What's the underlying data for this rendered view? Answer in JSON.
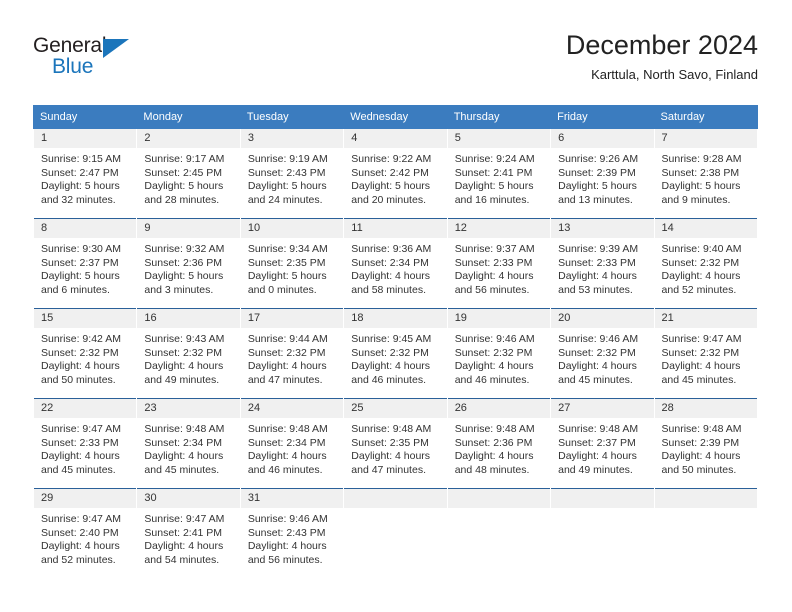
{
  "logo": {
    "word_top": "General",
    "word_bottom": "Blue",
    "triangle_color": "#1b75bb"
  },
  "header": {
    "title": "December 2024",
    "location": "Karttula, North Savo, Finland"
  },
  "theme": {
    "header_blue": "#3b7cbf",
    "rule_blue": "#2a6099",
    "daynum_background": "#f0f0f0",
    "text": "#333333"
  },
  "calendar": {
    "weekday_headers": [
      "Sunday",
      "Monday",
      "Tuesday",
      "Wednesday",
      "Thursday",
      "Friday",
      "Saturday"
    ],
    "labels": {
      "sunrise": "Sunrise:",
      "sunset": "Sunset:",
      "daylight": "Daylight:"
    },
    "weeks": [
      [
        {
          "day": "1",
          "sunrise": "Sunrise: 9:15 AM",
          "sunset": "Sunset: 2:47 PM",
          "daylight_1": "Daylight: 5 hours",
          "daylight_2": "and 32 minutes."
        },
        {
          "day": "2",
          "sunrise": "Sunrise: 9:17 AM",
          "sunset": "Sunset: 2:45 PM",
          "daylight_1": "Daylight: 5 hours",
          "daylight_2": "and 28 minutes."
        },
        {
          "day": "3",
          "sunrise": "Sunrise: 9:19 AM",
          "sunset": "Sunset: 2:43 PM",
          "daylight_1": "Daylight: 5 hours",
          "daylight_2": "and 24 minutes."
        },
        {
          "day": "4",
          "sunrise": "Sunrise: 9:22 AM",
          "sunset": "Sunset: 2:42 PM",
          "daylight_1": "Daylight: 5 hours",
          "daylight_2": "and 20 minutes."
        },
        {
          "day": "5",
          "sunrise": "Sunrise: 9:24 AM",
          "sunset": "Sunset: 2:41 PM",
          "daylight_1": "Daylight: 5 hours",
          "daylight_2": "and 16 minutes."
        },
        {
          "day": "6",
          "sunrise": "Sunrise: 9:26 AM",
          "sunset": "Sunset: 2:39 PM",
          "daylight_1": "Daylight: 5 hours",
          "daylight_2": "and 13 minutes."
        },
        {
          "day": "7",
          "sunrise": "Sunrise: 9:28 AM",
          "sunset": "Sunset: 2:38 PM",
          "daylight_1": "Daylight: 5 hours",
          "daylight_2": "and 9 minutes."
        }
      ],
      [
        {
          "day": "8",
          "sunrise": "Sunrise: 9:30 AM",
          "sunset": "Sunset: 2:37 PM",
          "daylight_1": "Daylight: 5 hours",
          "daylight_2": "and 6 minutes."
        },
        {
          "day": "9",
          "sunrise": "Sunrise: 9:32 AM",
          "sunset": "Sunset: 2:36 PM",
          "daylight_1": "Daylight: 5 hours",
          "daylight_2": "and 3 minutes."
        },
        {
          "day": "10",
          "sunrise": "Sunrise: 9:34 AM",
          "sunset": "Sunset: 2:35 PM",
          "daylight_1": "Daylight: 5 hours",
          "daylight_2": "and 0 minutes."
        },
        {
          "day": "11",
          "sunrise": "Sunrise: 9:36 AM",
          "sunset": "Sunset: 2:34 PM",
          "daylight_1": "Daylight: 4 hours",
          "daylight_2": "and 58 minutes."
        },
        {
          "day": "12",
          "sunrise": "Sunrise: 9:37 AM",
          "sunset": "Sunset: 2:33 PM",
          "daylight_1": "Daylight: 4 hours",
          "daylight_2": "and 56 minutes."
        },
        {
          "day": "13",
          "sunrise": "Sunrise: 9:39 AM",
          "sunset": "Sunset: 2:33 PM",
          "daylight_1": "Daylight: 4 hours",
          "daylight_2": "and 53 minutes."
        },
        {
          "day": "14",
          "sunrise": "Sunrise: 9:40 AM",
          "sunset": "Sunset: 2:32 PM",
          "daylight_1": "Daylight: 4 hours",
          "daylight_2": "and 52 minutes."
        }
      ],
      [
        {
          "day": "15",
          "sunrise": "Sunrise: 9:42 AM",
          "sunset": "Sunset: 2:32 PM",
          "daylight_1": "Daylight: 4 hours",
          "daylight_2": "and 50 minutes."
        },
        {
          "day": "16",
          "sunrise": "Sunrise: 9:43 AM",
          "sunset": "Sunset: 2:32 PM",
          "daylight_1": "Daylight: 4 hours",
          "daylight_2": "and 49 minutes."
        },
        {
          "day": "17",
          "sunrise": "Sunrise: 9:44 AM",
          "sunset": "Sunset: 2:32 PM",
          "daylight_1": "Daylight: 4 hours",
          "daylight_2": "and 47 minutes."
        },
        {
          "day": "18",
          "sunrise": "Sunrise: 9:45 AM",
          "sunset": "Sunset: 2:32 PM",
          "daylight_1": "Daylight: 4 hours",
          "daylight_2": "and 46 minutes."
        },
        {
          "day": "19",
          "sunrise": "Sunrise: 9:46 AM",
          "sunset": "Sunset: 2:32 PM",
          "daylight_1": "Daylight: 4 hours",
          "daylight_2": "and 46 minutes."
        },
        {
          "day": "20",
          "sunrise": "Sunrise: 9:46 AM",
          "sunset": "Sunset: 2:32 PM",
          "daylight_1": "Daylight: 4 hours",
          "daylight_2": "and 45 minutes."
        },
        {
          "day": "21",
          "sunrise": "Sunrise: 9:47 AM",
          "sunset": "Sunset: 2:32 PM",
          "daylight_1": "Daylight: 4 hours",
          "daylight_2": "and 45 minutes."
        }
      ],
      [
        {
          "day": "22",
          "sunrise": "Sunrise: 9:47 AM",
          "sunset": "Sunset: 2:33 PM",
          "daylight_1": "Daylight: 4 hours",
          "daylight_2": "and 45 minutes."
        },
        {
          "day": "23",
          "sunrise": "Sunrise: 9:48 AM",
          "sunset": "Sunset: 2:34 PM",
          "daylight_1": "Daylight: 4 hours",
          "daylight_2": "and 45 minutes."
        },
        {
          "day": "24",
          "sunrise": "Sunrise: 9:48 AM",
          "sunset": "Sunset: 2:34 PM",
          "daylight_1": "Daylight: 4 hours",
          "daylight_2": "and 46 minutes."
        },
        {
          "day": "25",
          "sunrise": "Sunrise: 9:48 AM",
          "sunset": "Sunset: 2:35 PM",
          "daylight_1": "Daylight: 4 hours",
          "daylight_2": "and 47 minutes."
        },
        {
          "day": "26",
          "sunrise": "Sunrise: 9:48 AM",
          "sunset": "Sunset: 2:36 PM",
          "daylight_1": "Daylight: 4 hours",
          "daylight_2": "and 48 minutes."
        },
        {
          "day": "27",
          "sunrise": "Sunrise: 9:48 AM",
          "sunset": "Sunset: 2:37 PM",
          "daylight_1": "Daylight: 4 hours",
          "daylight_2": "and 49 minutes."
        },
        {
          "day": "28",
          "sunrise": "Sunrise: 9:48 AM",
          "sunset": "Sunset: 2:39 PM",
          "daylight_1": "Daylight: 4 hours",
          "daylight_2": "and 50 minutes."
        }
      ],
      [
        {
          "day": "29",
          "sunrise": "Sunrise: 9:47 AM",
          "sunset": "Sunset: 2:40 PM",
          "daylight_1": "Daylight: 4 hours",
          "daylight_2": "and 52 minutes."
        },
        {
          "day": "30",
          "sunrise": "Sunrise: 9:47 AM",
          "sunset": "Sunset: 2:41 PM",
          "daylight_1": "Daylight: 4 hours",
          "daylight_2": "and 54 minutes."
        },
        {
          "day": "31",
          "sunrise": "Sunrise: 9:46 AM",
          "sunset": "Sunset: 2:43 PM",
          "daylight_1": "Daylight: 4 hours",
          "daylight_2": "and 56 minutes."
        },
        {
          "day": "",
          "sunrise": "",
          "sunset": "",
          "daylight_1": "",
          "daylight_2": ""
        },
        {
          "day": "",
          "sunrise": "",
          "sunset": "",
          "daylight_1": "",
          "daylight_2": ""
        },
        {
          "day": "",
          "sunrise": "",
          "sunset": "",
          "daylight_1": "",
          "daylight_2": ""
        },
        {
          "day": "",
          "sunrise": "",
          "sunset": "",
          "daylight_1": "",
          "daylight_2": ""
        }
      ]
    ]
  }
}
